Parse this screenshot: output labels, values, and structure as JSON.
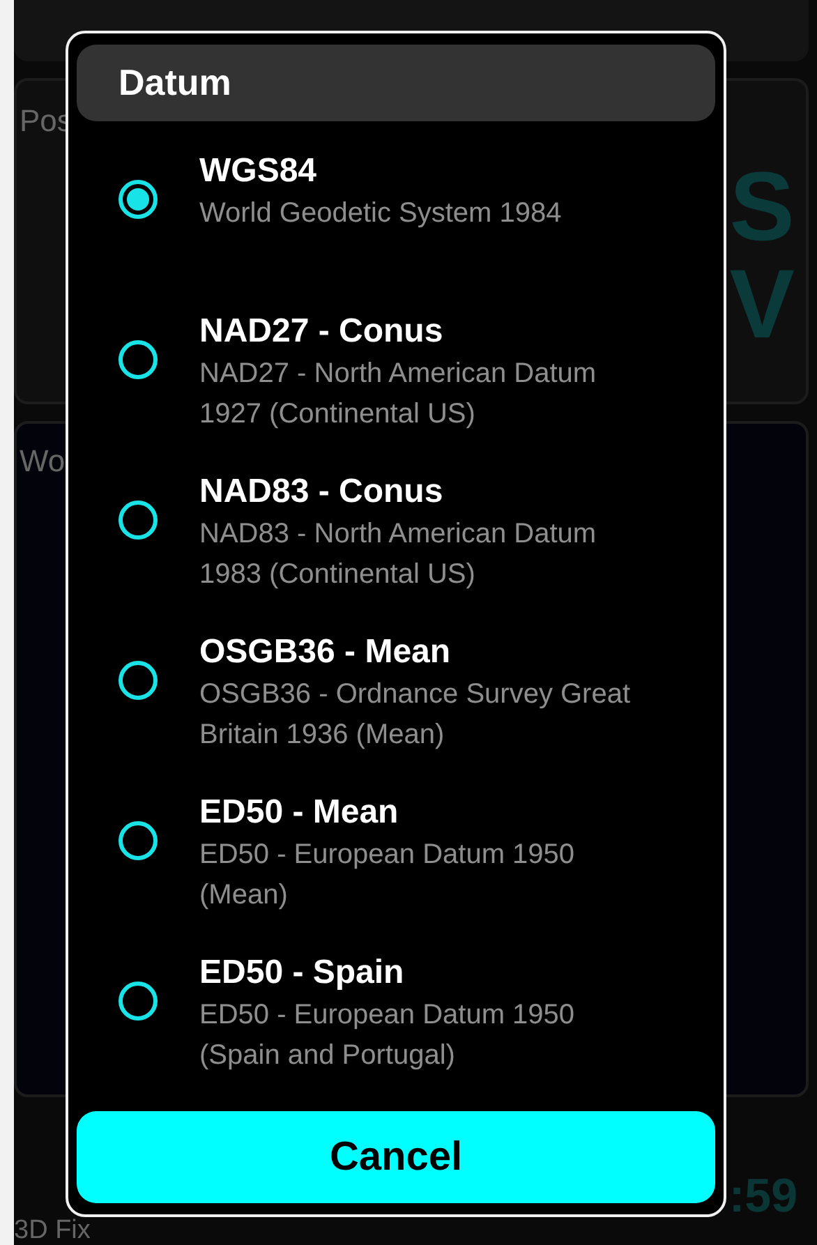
{
  "background": {
    "position_label": "Pos",
    "big_letters": [
      "S",
      "V"
    ],
    "world_label": "Wo",
    "fix_label": "3D Fix",
    "time_fragment": ":59"
  },
  "dialog": {
    "title": "Datum",
    "options": [
      {
        "name": "WGS84",
        "description": "World Geodetic System 1984",
        "selected": true
      },
      {
        "name": "NAD27 - Conus",
        "description": "NAD27 - North American Datum 1927 (Continental US)",
        "selected": false
      },
      {
        "name": "NAD83 - Conus",
        "description": "NAD83 - North American Datum 1983 (Continental US)",
        "selected": false
      },
      {
        "name": "OSGB36 - Mean",
        "description": "OSGB36 - Ordnance Survey Great Britain 1936 (Mean)",
        "selected": false
      },
      {
        "name": "ED50 - Mean",
        "description": "ED50 - European Datum 1950 (Mean)",
        "selected": false
      },
      {
        "name": "ED50 - Spain",
        "description": "ED50 - European Datum 1950 (Spain and Portugal)",
        "selected": false
      }
    ],
    "cancel": "Cancel"
  }
}
